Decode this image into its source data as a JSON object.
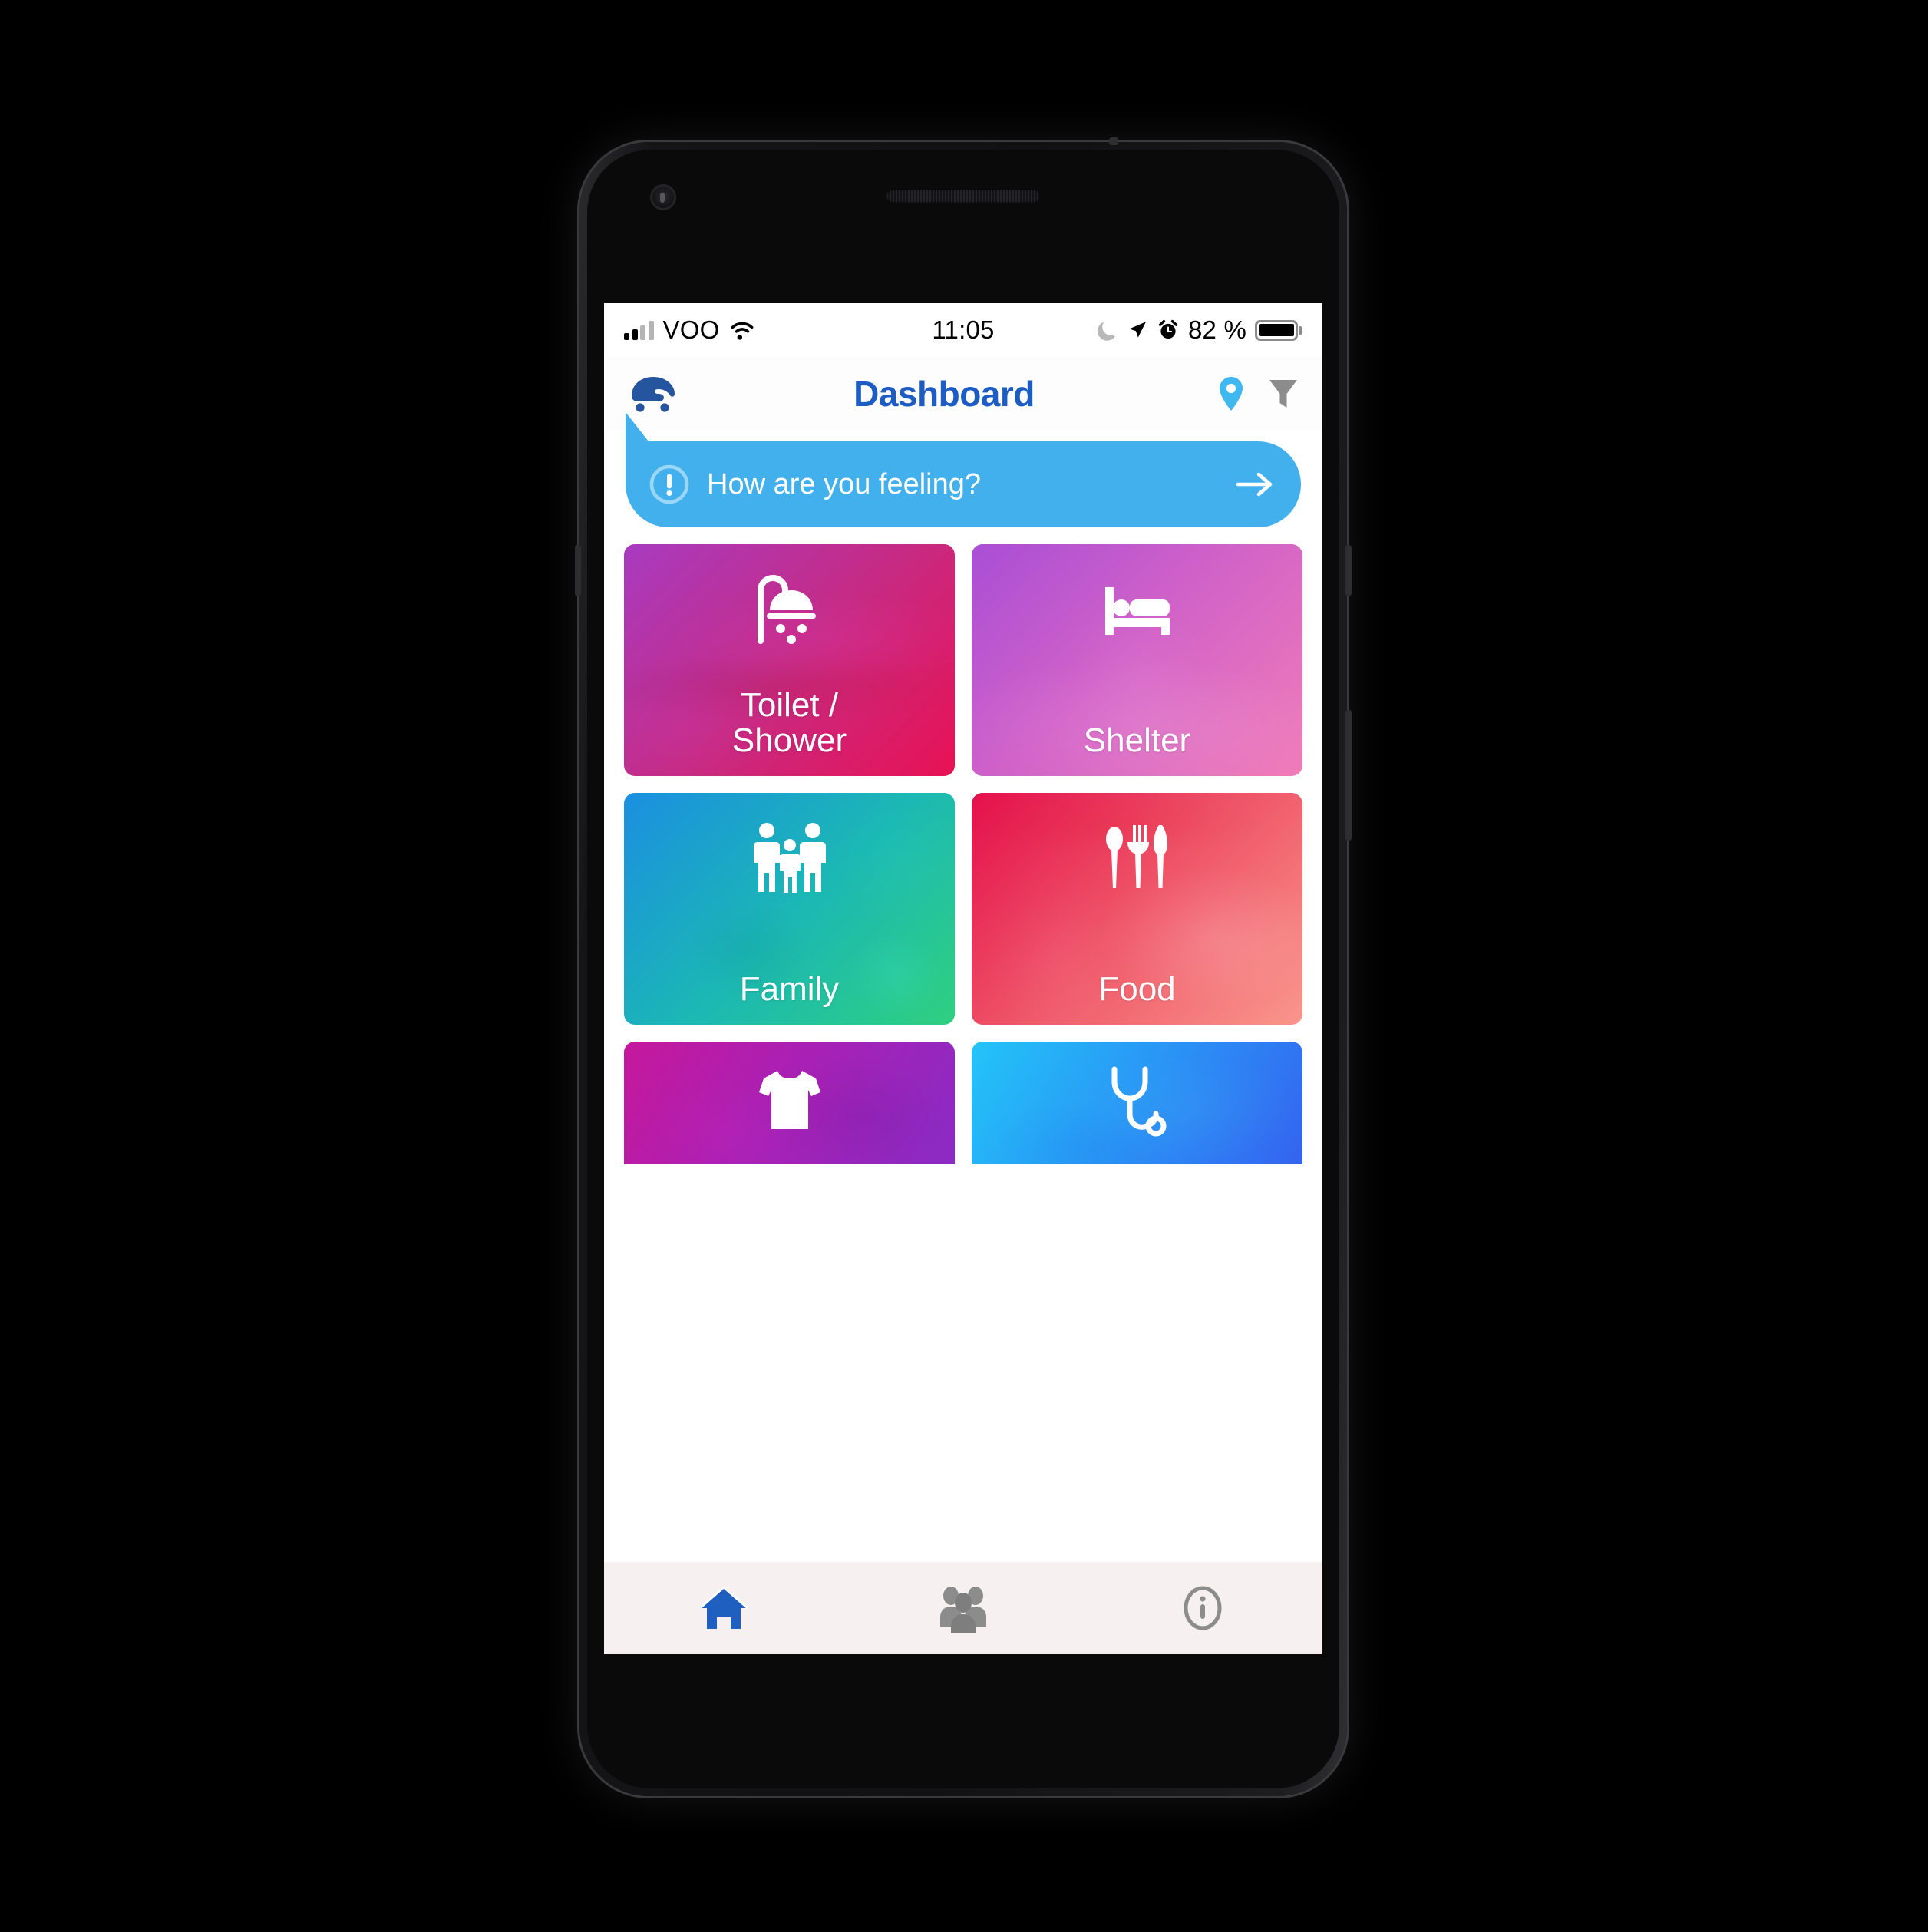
{
  "status_bar": {
    "carrier": "VOO",
    "time": "11:05",
    "battery_percent": "82 %",
    "icons": {
      "signal": "signal-bars-icon",
      "wifi": "wifi-icon",
      "dnd": "moon-icon",
      "location": "location-arrow-icon",
      "alarm": "alarm-clock-icon",
      "battery": "battery-icon"
    }
  },
  "header": {
    "title": "Dashboard",
    "logo_name": "app-logo-icon",
    "actions": [
      {
        "name": "map-pin-icon",
        "color": "#3fb8f0"
      },
      {
        "name": "filter-funnel-icon",
        "color": "#8c8c8c"
      }
    ]
  },
  "feeling_banner": {
    "text": "How are you feeling?",
    "alert_icon": "exclamation-circle-icon",
    "arrow_icon": "arrow-right-icon",
    "color": "#41b0ed"
  },
  "tiles": [
    {
      "label": "Toilet /\nShower",
      "label_line1": "Toilet /",
      "label_line2": "Shower",
      "icon": "shower-icon",
      "gradient_from": "#a83bc0",
      "gradient_to": "#e81254"
    },
    {
      "label": "Shelter",
      "icon": "bed-icon",
      "gradient_from": "#a94ed6",
      "gradient_to": "#f07cb8"
    },
    {
      "label": "Family",
      "icon": "family-icon",
      "gradient_from": "#1b8fe0",
      "gradient_to": "#2fd07f"
    },
    {
      "label": "Food",
      "icon": "cutlery-icon",
      "gradient_from": "#e4104b",
      "gradient_to": "#f9968c"
    },
    {
      "label": "",
      "icon": "tshirt-icon",
      "gradient_from": "#c5189b",
      "gradient_to": "#8a2bc4"
    },
    {
      "label": "",
      "icon": "stethoscope-icon",
      "gradient_from": "#23c4f8",
      "gradient_to": "#3463f0"
    }
  ],
  "bottom_nav": [
    {
      "name": "home-icon",
      "active": true,
      "color": "#1f5fbf"
    },
    {
      "name": "people-icon",
      "active": false,
      "color": "#8c8c8c"
    },
    {
      "name": "info-icon",
      "active": false,
      "color": "#8c8c8c"
    }
  ]
}
